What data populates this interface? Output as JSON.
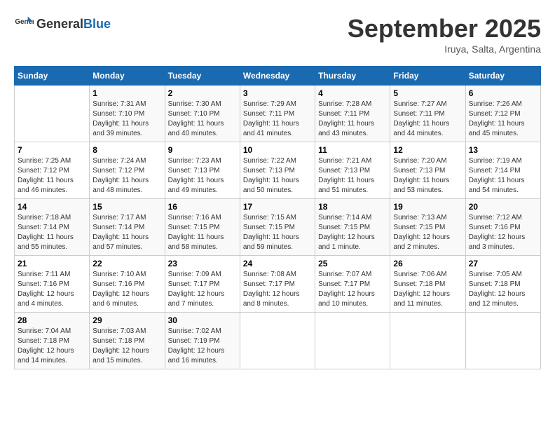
{
  "logo": {
    "text_general": "General",
    "text_blue": "Blue"
  },
  "title": "September 2025",
  "subtitle": "Iruya, Salta, Argentina",
  "days_of_week": [
    "Sunday",
    "Monday",
    "Tuesday",
    "Wednesday",
    "Thursday",
    "Friday",
    "Saturday"
  ],
  "weeks": [
    [
      {
        "day": "",
        "info": ""
      },
      {
        "day": "1",
        "info": "Sunrise: 7:31 AM\nSunset: 7:10 PM\nDaylight: 11 hours\nand 39 minutes."
      },
      {
        "day": "2",
        "info": "Sunrise: 7:30 AM\nSunset: 7:10 PM\nDaylight: 11 hours\nand 40 minutes."
      },
      {
        "day": "3",
        "info": "Sunrise: 7:29 AM\nSunset: 7:11 PM\nDaylight: 11 hours\nand 41 minutes."
      },
      {
        "day": "4",
        "info": "Sunrise: 7:28 AM\nSunset: 7:11 PM\nDaylight: 11 hours\nand 43 minutes."
      },
      {
        "day": "5",
        "info": "Sunrise: 7:27 AM\nSunset: 7:11 PM\nDaylight: 11 hours\nand 44 minutes."
      },
      {
        "day": "6",
        "info": "Sunrise: 7:26 AM\nSunset: 7:12 PM\nDaylight: 11 hours\nand 45 minutes."
      }
    ],
    [
      {
        "day": "7",
        "info": "Sunrise: 7:25 AM\nSunset: 7:12 PM\nDaylight: 11 hours\nand 46 minutes."
      },
      {
        "day": "8",
        "info": "Sunrise: 7:24 AM\nSunset: 7:12 PM\nDaylight: 11 hours\nand 48 minutes."
      },
      {
        "day": "9",
        "info": "Sunrise: 7:23 AM\nSunset: 7:13 PM\nDaylight: 11 hours\nand 49 minutes."
      },
      {
        "day": "10",
        "info": "Sunrise: 7:22 AM\nSunset: 7:13 PM\nDaylight: 11 hours\nand 50 minutes."
      },
      {
        "day": "11",
        "info": "Sunrise: 7:21 AM\nSunset: 7:13 PM\nDaylight: 11 hours\nand 51 minutes."
      },
      {
        "day": "12",
        "info": "Sunrise: 7:20 AM\nSunset: 7:13 PM\nDaylight: 11 hours\nand 53 minutes."
      },
      {
        "day": "13",
        "info": "Sunrise: 7:19 AM\nSunset: 7:14 PM\nDaylight: 11 hours\nand 54 minutes."
      }
    ],
    [
      {
        "day": "14",
        "info": "Sunrise: 7:18 AM\nSunset: 7:14 PM\nDaylight: 11 hours\nand 55 minutes."
      },
      {
        "day": "15",
        "info": "Sunrise: 7:17 AM\nSunset: 7:14 PM\nDaylight: 11 hours\nand 57 minutes."
      },
      {
        "day": "16",
        "info": "Sunrise: 7:16 AM\nSunset: 7:15 PM\nDaylight: 11 hours\nand 58 minutes."
      },
      {
        "day": "17",
        "info": "Sunrise: 7:15 AM\nSunset: 7:15 PM\nDaylight: 11 hours\nand 59 minutes."
      },
      {
        "day": "18",
        "info": "Sunrise: 7:14 AM\nSunset: 7:15 PM\nDaylight: 12 hours\nand 1 minute."
      },
      {
        "day": "19",
        "info": "Sunrise: 7:13 AM\nSunset: 7:15 PM\nDaylight: 12 hours\nand 2 minutes."
      },
      {
        "day": "20",
        "info": "Sunrise: 7:12 AM\nSunset: 7:16 PM\nDaylight: 12 hours\nand 3 minutes."
      }
    ],
    [
      {
        "day": "21",
        "info": "Sunrise: 7:11 AM\nSunset: 7:16 PM\nDaylight: 12 hours\nand 4 minutes."
      },
      {
        "day": "22",
        "info": "Sunrise: 7:10 AM\nSunset: 7:16 PM\nDaylight: 12 hours\nand 6 minutes."
      },
      {
        "day": "23",
        "info": "Sunrise: 7:09 AM\nSunset: 7:17 PM\nDaylight: 12 hours\nand 7 minutes."
      },
      {
        "day": "24",
        "info": "Sunrise: 7:08 AM\nSunset: 7:17 PM\nDaylight: 12 hours\nand 8 minutes."
      },
      {
        "day": "25",
        "info": "Sunrise: 7:07 AM\nSunset: 7:17 PM\nDaylight: 12 hours\nand 10 minutes."
      },
      {
        "day": "26",
        "info": "Sunrise: 7:06 AM\nSunset: 7:18 PM\nDaylight: 12 hours\nand 11 minutes."
      },
      {
        "day": "27",
        "info": "Sunrise: 7:05 AM\nSunset: 7:18 PM\nDaylight: 12 hours\nand 12 minutes."
      }
    ],
    [
      {
        "day": "28",
        "info": "Sunrise: 7:04 AM\nSunset: 7:18 PM\nDaylight: 12 hours\nand 14 minutes."
      },
      {
        "day": "29",
        "info": "Sunrise: 7:03 AM\nSunset: 7:18 PM\nDaylight: 12 hours\nand 15 minutes."
      },
      {
        "day": "30",
        "info": "Sunrise: 7:02 AM\nSunset: 7:19 PM\nDaylight: 12 hours\nand 16 minutes."
      },
      {
        "day": "",
        "info": ""
      },
      {
        "day": "",
        "info": ""
      },
      {
        "day": "",
        "info": ""
      },
      {
        "day": "",
        "info": ""
      }
    ]
  ]
}
